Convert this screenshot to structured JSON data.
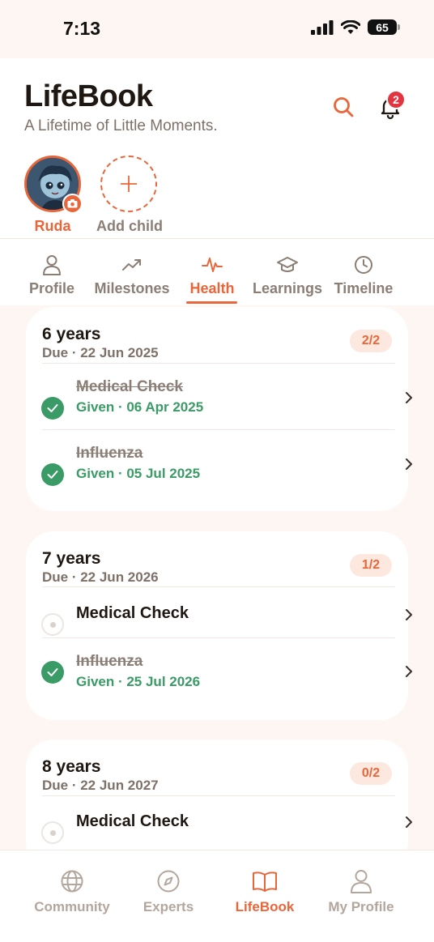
{
  "status_bar": {
    "time": "7:13",
    "battery": "65"
  },
  "header": {
    "title": "LifeBook",
    "subtitle": "A Lifetime of Little Moments.",
    "notification_count": "2"
  },
  "children": [
    {
      "name": "Ruda"
    }
  ],
  "add_child_label": "Add child",
  "tabs": [
    {
      "label": "Profile",
      "icon": "person-icon",
      "active": false
    },
    {
      "label": "Milestones",
      "icon": "trend-up-icon",
      "active": false
    },
    {
      "label": "Health",
      "icon": "pulse-icon",
      "active": true
    },
    {
      "label": "Learnings",
      "icon": "graduation-cap-icon",
      "active": false
    },
    {
      "label": "Timeline",
      "icon": "clock-icon",
      "active": false
    }
  ],
  "checkups": [
    {
      "age": "6 years",
      "due": "Due · 22 Jun 2025",
      "count": "2/2",
      "items": [
        {
          "name": "Medical Check",
          "status": "Given · 06 Apr 2025",
          "done": true
        },
        {
          "name": "Influenza",
          "status": "Given · 05 Jul 2025",
          "done": true
        }
      ]
    },
    {
      "age": "7 years",
      "due": "Due · 22 Jun 2026",
      "count": "1/2",
      "items": [
        {
          "name": "Medical Check",
          "done": false
        },
        {
          "name": "Influenza",
          "status": "Given · 25 Jul 2026",
          "done": true
        }
      ]
    },
    {
      "age": "8 years",
      "due": "Due · 22 Jun 2027",
      "count": "0/2",
      "items": [
        {
          "name": "Medical Check",
          "done": false
        }
      ]
    }
  ],
  "bottom_nav": [
    {
      "label": "Community",
      "icon": "globe-icon",
      "active": false
    },
    {
      "label": "Experts",
      "icon": "compass-icon",
      "active": false
    },
    {
      "label": "LifeBook",
      "icon": "book-icon",
      "active": true
    },
    {
      "label": "My Profile",
      "icon": "person-icon",
      "active": false
    }
  ],
  "colors": {
    "accent": "#e8663a",
    "success": "#3a9b66",
    "badge": "#e2353f",
    "background": "#fdf6f2"
  }
}
